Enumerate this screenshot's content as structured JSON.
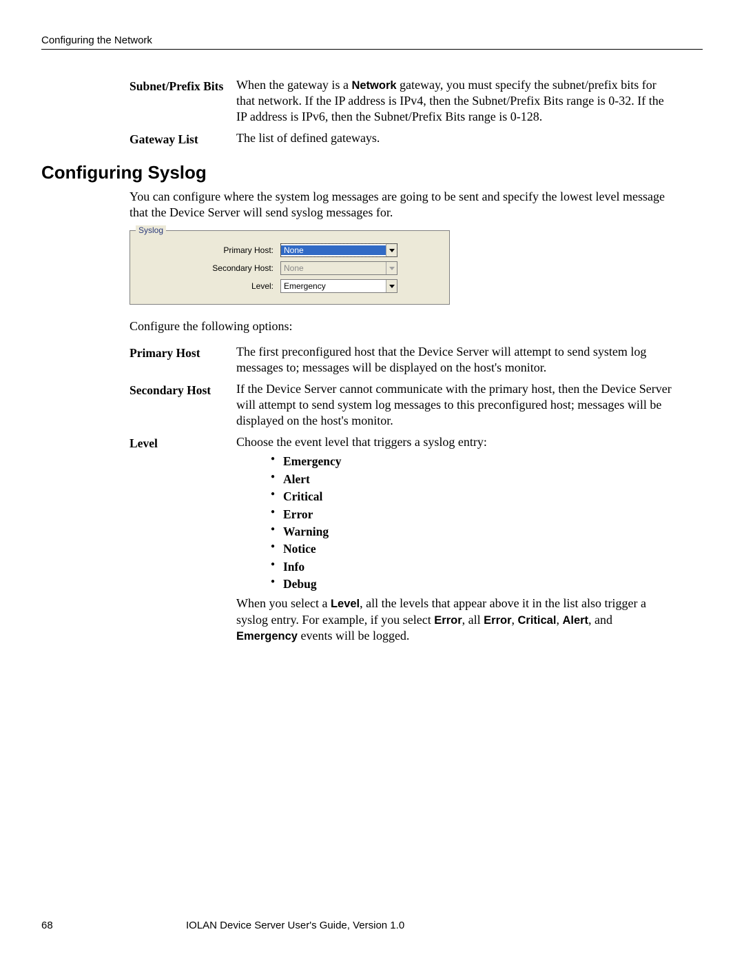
{
  "running_head": "Configuring the Network",
  "defs_top": {
    "subnet_prefix_bits": {
      "term": "Subnet/Prefix Bits",
      "desc_before": "When the gateway is a ",
      "desc_bold": "Network",
      "desc_after": " gateway, you must specify the subnet/prefix bits for that network. If the IP address is IPv4, then the Subnet/Prefix Bits range is 0-32. If the IP address is IPv6, then the Subnet/Prefix Bits range is 0-128."
    },
    "gateway_list": {
      "term": "Gateway List",
      "desc": "The list of defined gateways."
    }
  },
  "section_heading": "Configuring Syslog",
  "intro_para": "You can configure where the system log messages are going to be sent and specify the lowest level message that the Device Server will send syslog messages for.",
  "syslog_box": {
    "legend": "Syslog",
    "rows": {
      "primary": {
        "label": "Primary Host:",
        "value": "None"
      },
      "secondary": {
        "label": "Secondary Host:",
        "value": "None"
      },
      "level": {
        "label": "Level:",
        "value": "Emergency"
      }
    }
  },
  "configure_line": "Configure the following options:",
  "defs_syslog": {
    "primary_host": {
      "term": "Primary Host",
      "desc": "The first preconfigured host that the Device Server will attempt to send system log messages to; messages will be displayed on the host's monitor."
    },
    "secondary_host": {
      "term": "Secondary Host",
      "desc": "If the Device Server cannot communicate with the primary host, then the Device Server will attempt to send system log messages to this preconfigured host; messages will be displayed on the host's monitor."
    },
    "level": {
      "term": "Level",
      "intro": "Choose the event level that triggers a syslog entry:",
      "items": [
        "Emergency",
        "Alert",
        "Critical",
        "Error",
        "Warning",
        "Notice",
        "Info",
        "Debug"
      ],
      "trail_1a": "When you select a ",
      "trail_1b": "Level",
      "trail_1c": ", all the levels that appear above it in the list also trigger a syslog entry. For example, if you select ",
      "trail_err1": "Error",
      "trail_mid1": ", all ",
      "trail_err2": "Error",
      "trail_mid2": ", ",
      "trail_crit": "Critical",
      "trail_mid3": ", ",
      "trail_alert": "Alert",
      "trail_mid4": ", and ",
      "trail_emerg": "Emergency",
      "trail_end": " events will be logged."
    }
  },
  "footer": {
    "page_number": "68",
    "title": "IOLAN Device Server User's Guide, Version 1.0"
  }
}
